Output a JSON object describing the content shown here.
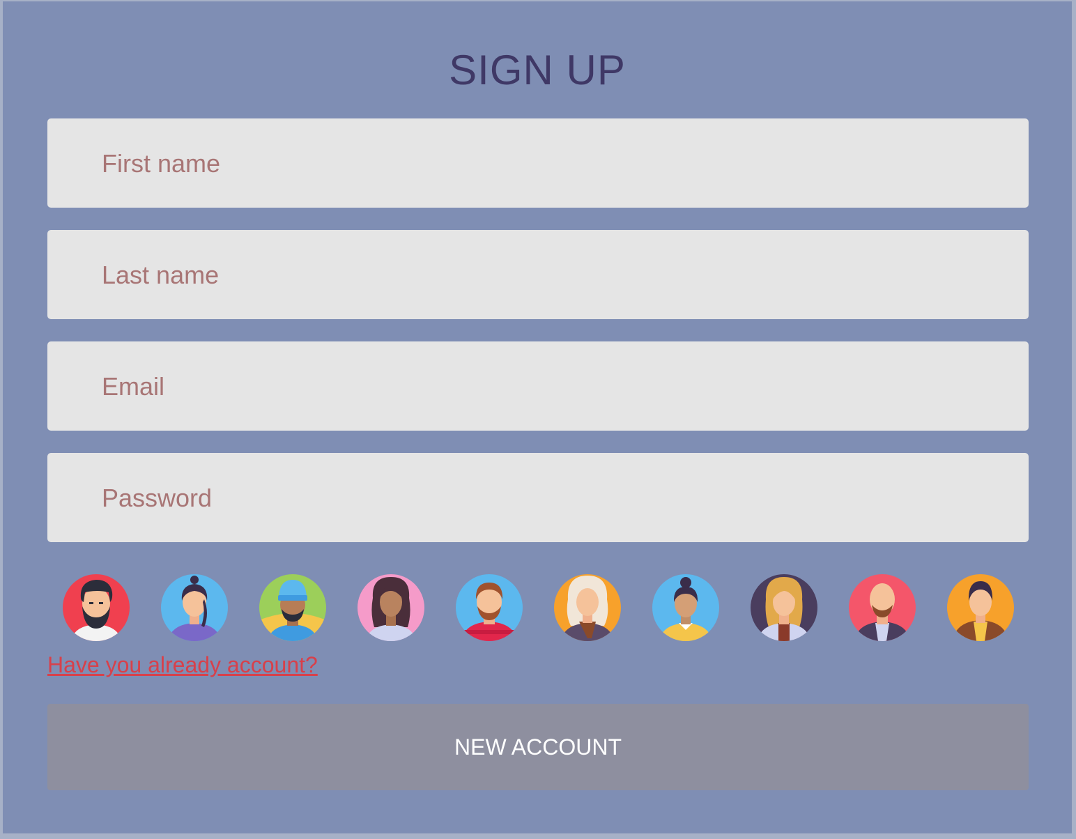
{
  "form": {
    "title": "SIGN UP",
    "fields": [
      {
        "label": "First name"
      },
      {
        "label": "Last name"
      },
      {
        "label": "Email"
      },
      {
        "label": "Password"
      }
    ],
    "login_link": "Have you already account?",
    "submit_label": "NEW ACCOUNT"
  },
  "avatars": [
    {
      "name": "bearded-man-avatar",
      "bg": "#f0404f"
    },
    {
      "name": "woman-ponytail-avatar",
      "bg": "#5cb8ee"
    },
    {
      "name": "man-beanie-avatar",
      "bg": "#9ccf5a"
    },
    {
      "name": "woman-curly-hair-avatar",
      "bg": "#f59bc9"
    },
    {
      "name": "man-beard-avatar",
      "bg": "#5cb8ee"
    },
    {
      "name": "older-woman-avatar",
      "bg": "#f7a12b"
    },
    {
      "name": "woman-bun-avatar",
      "bg": "#5cb8ee"
    },
    {
      "name": "blonde-woman-avatar",
      "bg": "#4a3d5e"
    },
    {
      "name": "bald-man-avatar",
      "bg": "#f4566a"
    },
    {
      "name": "man-hoodie-avatar",
      "bg": "#f7a12b"
    }
  ]
}
